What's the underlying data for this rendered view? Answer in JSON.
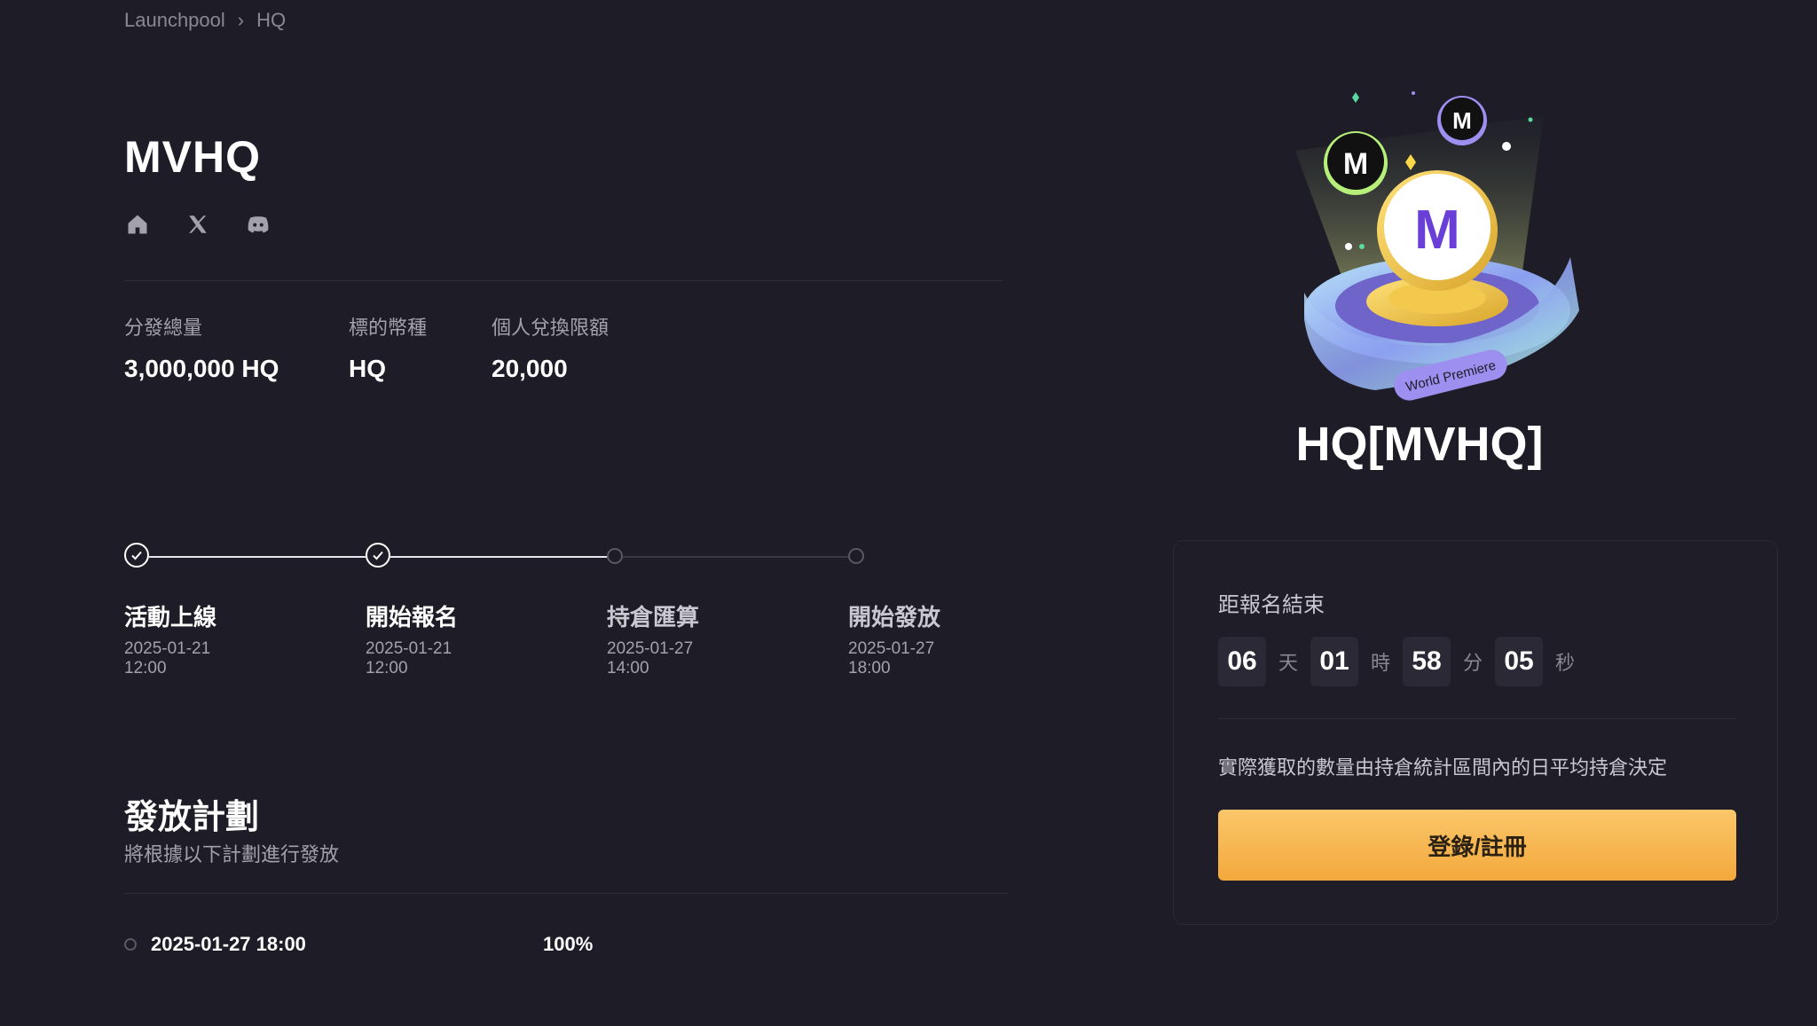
{
  "breadcrumb": {
    "root": "Launchpool",
    "current": "HQ"
  },
  "project": {
    "title": "MVHQ"
  },
  "socials": [
    {
      "icon": "home-icon"
    },
    {
      "icon": "x-twitter-icon"
    },
    {
      "icon": "discord-icon"
    }
  ],
  "stats": [
    {
      "label": "分發總量",
      "value": "3,000,000 HQ"
    },
    {
      "label": "標的幣種",
      "value": "HQ"
    },
    {
      "label": "個人兌換限額",
      "value": "20,000"
    }
  ],
  "timeline": [
    {
      "name": "活動上線",
      "date": "2025-01-21",
      "time": "12:00",
      "done": true
    },
    {
      "name": "開始報名",
      "date": "2025-01-21",
      "time": "12:00",
      "done": true
    },
    {
      "name": "持倉匯算",
      "date": "2025-01-27",
      "time": "14:00",
      "done": false
    },
    {
      "name": "開始發放",
      "date": "2025-01-27",
      "time": "18:00",
      "done": false
    }
  ],
  "plan": {
    "title": "發放計劃",
    "subtitle": "將根據以下計劃進行發放",
    "rows": [
      {
        "datetime": "2025-01-27 18:00",
        "percent": "100%"
      }
    ]
  },
  "hero": {
    "badge_text": "World Premiere",
    "token_title": "HQ[MVHQ]"
  },
  "panel": {
    "countdown_label": "距報名結束",
    "countdown": [
      {
        "value": "06",
        "unit": "天"
      },
      {
        "value": "01",
        "unit": "時"
      },
      {
        "value": "58",
        "unit": "分"
      },
      {
        "value": "05",
        "unit": "秒"
      }
    ],
    "note": "實際獲取的數量由持倉統計區間內的日平均持倉決定",
    "cta_label": "登錄/註冊"
  },
  "colors": {
    "background": "#1e1c27",
    "accent": "#f3a83c",
    "muted": "#a3a1ab"
  }
}
